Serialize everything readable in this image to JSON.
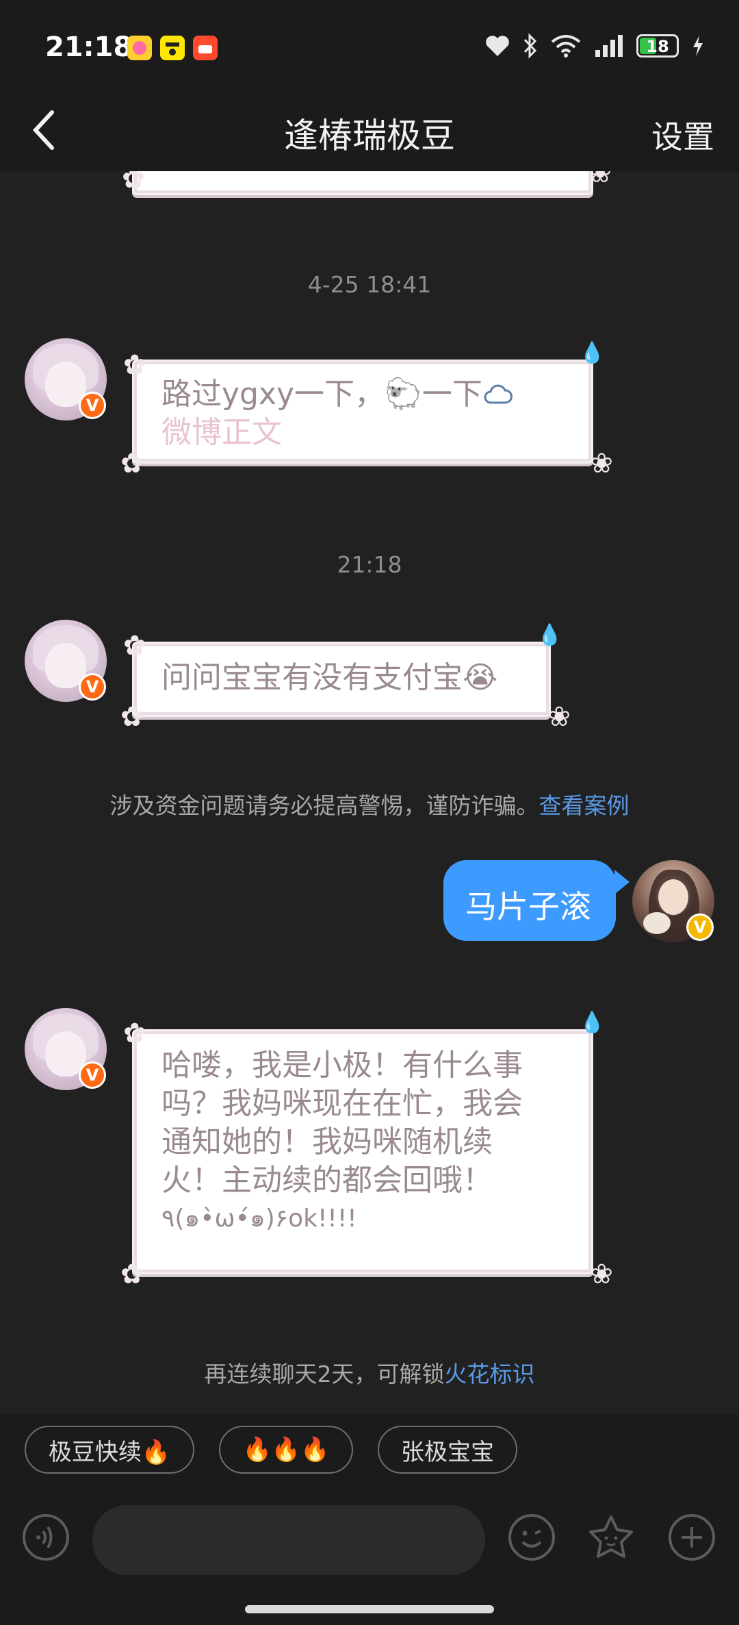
{
  "status_bar": {
    "time": "21:18",
    "battery_level": "18",
    "app_icons": [
      "app-icon-pink",
      "app-icon-yellow",
      "app-icon-red"
    ],
    "indicator_icons": [
      "heart-icon",
      "bluetooth-icon",
      "wifi-icon",
      "signal-icon",
      "charging-icon"
    ]
  },
  "nav": {
    "title": "逢椿瑞极豆",
    "settings_label": "设置"
  },
  "chat": {
    "timestamps": [
      "4-25 18:41",
      "21:18"
    ],
    "messages": [
      {
        "sender": "other",
        "text": "路过ygxy一下，🐑一下",
        "link_text": "微博正文"
      },
      {
        "sender": "other",
        "text": "问问宝宝有没有支付宝😭"
      },
      {
        "sender": "me",
        "text": "马片子滚"
      },
      {
        "sender": "other",
        "lines": [
          "哈喽，我是小极！有什么事",
          "吗？我妈咪现在在忙，我会",
          "通知她的！我妈咪随机续",
          "火！主动续的都会回哦！",
          "٩(๑•̀ω•́๑)۶ok!!!!"
        ]
      }
    ],
    "fraud_notice": {
      "text": "涉及资金问题请务必提高警惕，谨防诈骗。",
      "link": "查看案例"
    },
    "streak_notice": {
      "text": "再连续聊天2天，可解锁",
      "link": "火花标识"
    }
  },
  "quick_replies": [
    "极豆快续🔥",
    "🔥🔥🔥",
    "张极宝宝"
  ],
  "input": {
    "placeholder": "",
    "icons": [
      "voice-icon",
      "emoji-icon",
      "sticker-icon",
      "add-icon"
    ]
  },
  "colors": {
    "my_bubble": "#3d9bff",
    "link": "#5a9be8",
    "badge_orange": "#ff6a14",
    "badge_gold": "#f5b800"
  }
}
